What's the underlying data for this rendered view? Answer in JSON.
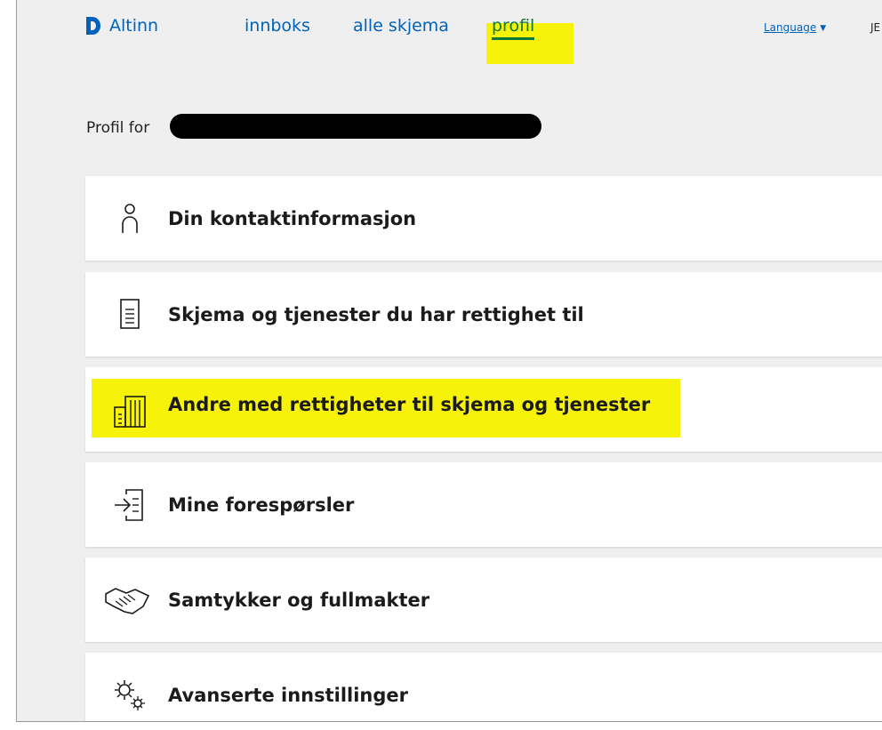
{
  "header": {
    "logo_text": "Altinn",
    "nav": {
      "inbox": "innboks",
      "all_forms": "alle skjema",
      "profile": "profil"
    },
    "language": "Language",
    "user_initials": "JE"
  },
  "profile": {
    "prefix": "Profil for"
  },
  "cards": [
    {
      "label": "Din kontaktinformasjon",
      "icon": "person-icon"
    },
    {
      "label": "Skjema og tjenester du har rettighet til",
      "icon": "document-icon"
    },
    {
      "label": "Andre med rettigheter til skjema og tjenester",
      "icon": "building-icon"
    },
    {
      "label": "Mine forespørsler",
      "icon": "request-arrow-icon"
    },
    {
      "label": "Samtykker og fullmakter",
      "icon": "handshake-icon"
    },
    {
      "label": "Avanserte innstillinger",
      "icon": "gears-icon"
    }
  ],
  "colors": {
    "link": "#0062ba",
    "active": "#0b7a37",
    "highlight": "#f6f20a",
    "background": "#efefef"
  }
}
